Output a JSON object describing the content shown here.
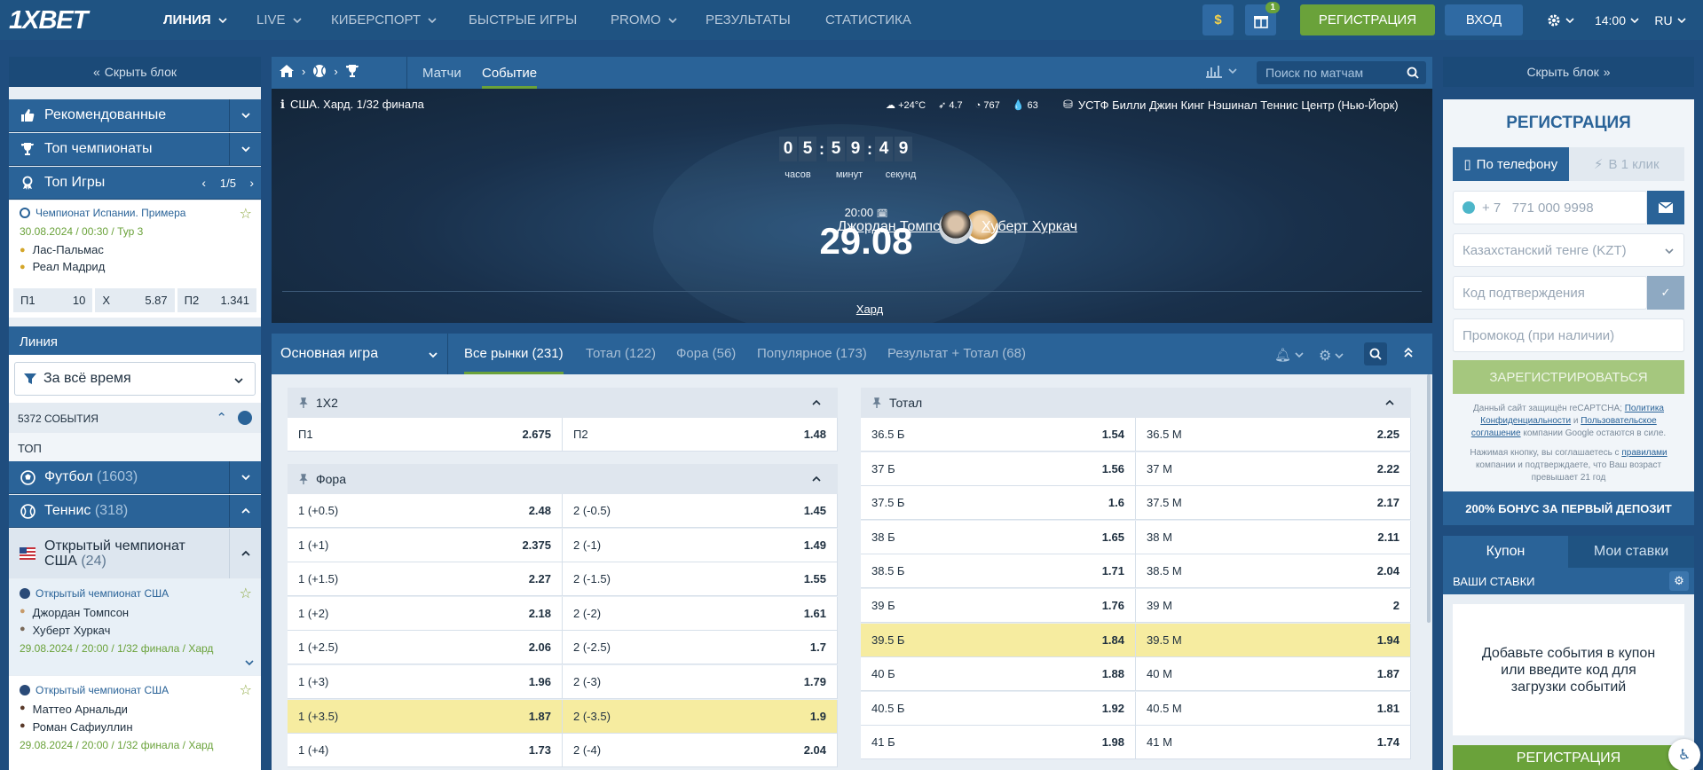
{
  "header": {
    "logo": "1XBET",
    "nav": [
      "ЛИНИЯ",
      "LIVE",
      "КИБЕРСПОРТ",
      "БЫСТРЫЕ ИГРЫ",
      "PROMO",
      "РЕЗУЛЬТАТЫ",
      "СТАТИСТИКА"
    ],
    "gift_badge": "1",
    "register": "РЕГИСТРАЦИЯ",
    "login": "ВХОД",
    "time": "14:00",
    "lang": "RU"
  },
  "left": {
    "hide_block": "Скрыть блок",
    "menu": [
      "Рекомендованные",
      "Топ чемпионаты",
      "Топ Игры"
    ],
    "top_games_page": "1/5",
    "top_game": {
      "league": "Чемпионат Испании. Примера",
      "date": "30.08.2024 / 00:30 / Тур 3",
      "team1": "Лас-Пальмас",
      "team2": "Реал Мадрид",
      "odds": [
        {
          "label": "П1",
          "value": "10"
        },
        {
          "label": "X",
          "value": "5.87"
        },
        {
          "label": "П2",
          "value": "1.341"
        }
      ]
    },
    "line_title": "Линия",
    "period": "За всё время",
    "events_count": "5372",
    "events_label": "СОБЫТИЯ",
    "top_label": "ТОП",
    "sports": [
      {
        "name": "Футбол",
        "count": "(1603)"
      },
      {
        "name": "Теннис",
        "count": "(318)"
      }
    ],
    "tournament": {
      "name": "Открытый чемпионат США",
      "count": "(24)"
    },
    "matches": [
      {
        "league": "Открытый чемпионат США",
        "p1": "Джордан Томпсон",
        "p2": "Хуберт Хуркач",
        "info": "29.08.2024 / 20:00 / 1/32 финала / Хард"
      },
      {
        "league": "Открытый чемпионат США",
        "p1": "Маттео Арнальди",
        "p2": "Роман Сафиуллин",
        "info": "29.08.2024 / 20:00 / 1/32 финала / Хард"
      }
    ]
  },
  "center": {
    "tabs": [
      "Матчи",
      "Событие"
    ],
    "search_placeholder": "Поиск по матчам",
    "event_title": "США. Хард. 1/32 финала",
    "weather": {
      "temp": "+24°C",
      "wind": "4.7",
      "pressure": "767",
      "humidity": "63"
    },
    "venue": "УСТФ Билли Джин Кинг Нэшинал Теннис Центр (Нью-Йорк)",
    "countdown": {
      "digits": [
        "0",
        "5",
        "5",
        "9",
        "4",
        "9"
      ],
      "labels": [
        "часов",
        "минут",
        "секунд"
      ]
    },
    "player1": "Джордан Томпсон",
    "player2": "Хуберт Хуркач",
    "match_time": "20:00",
    "match_date": "29.08",
    "surface": "Хард",
    "market_select": "Основная игра",
    "market_tabs": [
      {
        "label": "Все рынки",
        "count": "(231)"
      },
      {
        "label": "Тотал",
        "count": "(122)"
      },
      {
        "label": "Фора",
        "count": "(56)"
      },
      {
        "label": "Популярное",
        "count": "(173)"
      },
      {
        "label": "Результат + Тотал",
        "count": "(68)"
      }
    ],
    "m1x2": {
      "title": "1X2",
      "cells": [
        {
          "l": "П1",
          "v": "2.675"
        },
        {
          "l": "П2",
          "v": "1.48"
        }
      ]
    },
    "handicap": {
      "title": "Фора",
      "rows": [
        [
          {
            "l": "1 (+0.5)",
            "v": "2.48"
          },
          {
            "l": "2 (-0.5)",
            "v": "1.45"
          }
        ],
        [
          {
            "l": "1 (+1)",
            "v": "2.375"
          },
          {
            "l": "2 (-1)",
            "v": "1.49"
          }
        ],
        [
          {
            "l": "1 (+1.5)",
            "v": "2.27"
          },
          {
            "l": "2 (-1.5)",
            "v": "1.55"
          }
        ],
        [
          {
            "l": "1 (+2)",
            "v": "2.18"
          },
          {
            "l": "2 (-2)",
            "v": "1.61"
          }
        ],
        [
          {
            "l": "1 (+2.5)",
            "v": "2.06"
          },
          {
            "l": "2 (-2.5)",
            "v": "1.7"
          }
        ],
        [
          {
            "l": "1 (+3)",
            "v": "1.96"
          },
          {
            "l": "2 (-3)",
            "v": "1.79"
          }
        ],
        [
          {
            "l": "1 (+3.5)",
            "v": "1.87"
          },
          {
            "l": "2 (-3.5)",
            "v": "1.9"
          }
        ],
        [
          {
            "l": "1 (+4)",
            "v": "1.73"
          },
          {
            "l": "2 (-4)",
            "v": "2.04"
          }
        ]
      ]
    },
    "total": {
      "title": "Тотал",
      "rows": [
        [
          {
            "l": "36.5 Б",
            "v": "1.54"
          },
          {
            "l": "36.5 М",
            "v": "2.25"
          }
        ],
        [
          {
            "l": "37 Б",
            "v": "1.56"
          },
          {
            "l": "37 М",
            "v": "2.22"
          }
        ],
        [
          {
            "l": "37.5 Б",
            "v": "1.6"
          },
          {
            "l": "37.5 М",
            "v": "2.17"
          }
        ],
        [
          {
            "l": "38 Б",
            "v": "1.65"
          },
          {
            "l": "38 М",
            "v": "2.11"
          }
        ],
        [
          {
            "l": "38.5 Б",
            "v": "1.71"
          },
          {
            "l": "38.5 М",
            "v": "2.04"
          }
        ],
        [
          {
            "l": "39 Б",
            "v": "1.76"
          },
          {
            "l": "39 М",
            "v": "2"
          }
        ],
        [
          {
            "l": "39.5 Б",
            "v": "1.84"
          },
          {
            "l": "39.5 М",
            "v": "1.94"
          }
        ],
        [
          {
            "l": "40 Б",
            "v": "1.88"
          },
          {
            "l": "40 М",
            "v": "1.87"
          }
        ],
        [
          {
            "l": "40.5 Б",
            "v": "1.92"
          },
          {
            "l": "40.5 М",
            "v": "1.81"
          }
        ],
        [
          {
            "l": "41 Б",
            "v": "1.98"
          },
          {
            "l": "41 М",
            "v": "1.74"
          }
        ]
      ]
    }
  },
  "right": {
    "hide_block": "Скрыть блок",
    "reg_title": "РЕГИСТРАЦИЯ",
    "tab_phone": "По телефону",
    "tab_oneclick": "В 1 клик",
    "phone_code": "+ 7",
    "phone_placeholder": "771 000 9998",
    "currency": "Казахстанский тенге (KZT)",
    "code_placeholder": "Код подтверждения",
    "promo_placeholder": "Промокод (при наличии)",
    "submit": "ЗАРЕГИСТРИРОВАТЬСЯ",
    "recaptcha_1": "Данный сайт защищён reCAPTCHA;",
    "recaptcha_link1": "Политика Конфиденциальности",
    "recaptcha_and": "и",
    "recaptcha_link2": "Пользовательское соглашение",
    "recaptcha_2": "компании Google остаются в силе.",
    "agree_1": "Нажимая кнопку, вы соглашаетесь с",
    "agree_link": "правилами",
    "agree_2": "компании и подтверждаете, что Ваш возраст превышает 21 год",
    "bonus": "200% БОНУС ЗА ПЕРВЫЙ ДЕПОЗИТ",
    "coupon_tab": "Купон",
    "mybets_tab": "Мои ставки",
    "your_bets": "ВАШИ СТАВКИ",
    "empty_msg": "Добавьте события в купон или введите код для загрузки событий",
    "bottom_btn": "РЕГИСТРАЦИЯ"
  }
}
